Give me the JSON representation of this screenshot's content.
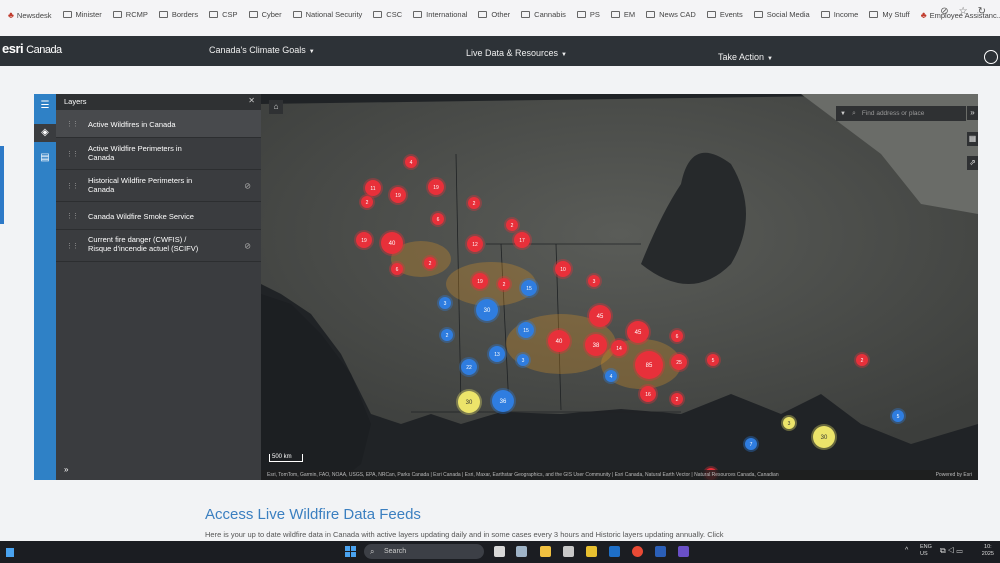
{
  "bookmarks": [
    {
      "label": "Newsdesk",
      "icon": "maple-leaf-icon"
    },
    {
      "label": "Minister",
      "icon": "folder-icon"
    },
    {
      "label": "RCMP",
      "icon": "folder-icon"
    },
    {
      "label": "Borders",
      "icon": "folder-icon"
    },
    {
      "label": "CSP",
      "icon": "folder-icon"
    },
    {
      "label": "Cyber",
      "icon": "folder-icon"
    },
    {
      "label": "National Security",
      "icon": "folder-icon"
    },
    {
      "label": "CSC",
      "icon": "folder-icon"
    },
    {
      "label": "International",
      "icon": "folder-icon"
    },
    {
      "label": "Other",
      "icon": "folder-icon"
    },
    {
      "label": "Cannabis",
      "icon": "folder-icon"
    },
    {
      "label": "PS",
      "icon": "folder-icon"
    },
    {
      "label": "EM",
      "icon": "folder-icon"
    },
    {
      "label": "News CAD",
      "icon": "folder-icon"
    },
    {
      "label": "Events",
      "icon": "folder-icon"
    },
    {
      "label": "Social Media",
      "icon": "folder-icon"
    },
    {
      "label": "Income",
      "icon": "folder-icon"
    },
    {
      "label": "My Stuff",
      "icon": "folder-icon"
    },
    {
      "label": "Employee Assistanc...",
      "icon": "maple-leaf-icon"
    }
  ],
  "header": {
    "logo": "esri",
    "logo_sub": "Canada",
    "nav": [
      "Canada's Climate Goals",
      "Live Data & Resources",
      "Take Action"
    ]
  },
  "layers": {
    "title": "Layers",
    "items": [
      {
        "label": "Active Wildfires in Canada",
        "visible": true
      },
      {
        "label": "Active Wildfire Perimeters in Canada",
        "visible": true
      },
      {
        "label": "Historical Wildfire Perimeters in Canada",
        "visible": false
      },
      {
        "label": "Canada Wildfire Smoke Service",
        "visible": true
      },
      {
        "label": "Current fire danger (CWFIS) / Risque d'incendie actuel (SCIFV)",
        "visible": false
      }
    ]
  },
  "map": {
    "search_placeholder": "Find address or place",
    "scale": "500 km",
    "attribution": "Esri, TomTom, Garmin, FAO, NOAA, USGS, EPA, NRCan, Parks Canada | Esri Canada | Esri, Maxar, Earthstar Geographics, and the GIS User Community | Esri Canada, Natural Earth Vector | Natural Resources Canada, Canadian",
    "powered_by": "Powered by Esri",
    "clusters": [
      {
        "n": "4",
        "c": "red"
      },
      {
        "n": "11",
        "c": "red"
      },
      {
        "n": "19",
        "c": "red"
      },
      {
        "n": "19",
        "c": "red"
      },
      {
        "n": "2",
        "c": "red"
      },
      {
        "n": "2",
        "c": "red"
      },
      {
        "n": "6",
        "c": "red"
      },
      {
        "n": "19",
        "c": "red"
      },
      {
        "n": "40",
        "c": "red"
      },
      {
        "n": "2",
        "c": "red"
      },
      {
        "n": "12",
        "c": "red"
      },
      {
        "n": "17",
        "c": "red"
      },
      {
        "n": "2",
        "c": "red"
      },
      {
        "n": "6",
        "c": "red"
      },
      {
        "n": "19",
        "c": "red"
      },
      {
        "n": "2",
        "c": "red"
      },
      {
        "n": "10",
        "c": "red"
      },
      {
        "n": "3",
        "c": "red"
      },
      {
        "n": "45",
        "c": "red"
      },
      {
        "n": "40",
        "c": "red"
      },
      {
        "n": "38",
        "c": "red"
      },
      {
        "n": "14",
        "c": "red"
      },
      {
        "n": "45",
        "c": "red"
      },
      {
        "n": "6",
        "c": "red"
      },
      {
        "n": "85",
        "c": "red"
      },
      {
        "n": "25",
        "c": "red"
      },
      {
        "n": "5",
        "c": "red"
      },
      {
        "n": "16",
        "c": "red"
      },
      {
        "n": "2",
        "c": "red"
      },
      {
        "n": "2",
        "c": "red"
      },
      {
        "n": "2",
        "c": "red"
      },
      {
        "n": "15",
        "c": "blue"
      },
      {
        "n": "3",
        "c": "blue"
      },
      {
        "n": "30",
        "c": "blue"
      },
      {
        "n": "2",
        "c": "blue"
      },
      {
        "n": "15",
        "c": "blue"
      },
      {
        "n": "13",
        "c": "blue"
      },
      {
        "n": "3",
        "c": "blue"
      },
      {
        "n": "22",
        "c": "blue"
      },
      {
        "n": "36",
        "c": "blue"
      },
      {
        "n": "4",
        "c": "blue"
      },
      {
        "n": "7",
        "c": "blue"
      },
      {
        "n": "5",
        "c": "blue"
      },
      {
        "n": "30",
        "c": "yellow"
      },
      {
        "n": "3",
        "c": "yellow"
      },
      {
        "n": "30",
        "c": "yellow"
      }
    ]
  },
  "section": {
    "title": "Access Live Wildfire Data Feeds",
    "body": "Here is your up to date wildfire data in Canada with active layers updating daily and in some cases every 3 hours and Historic layers updating annually. Click"
  },
  "taskbar": {
    "search_placeholder": "Search",
    "lang": "ENG",
    "region": "US",
    "time": "10:",
    "date": "2025"
  },
  "colors": {
    "red": "#e8303a",
    "blue": "#2f7de0",
    "yellow": "#ece46a",
    "nav": "#2d3237",
    "panel": "#3a3c3f",
    "accent": "#2f81c6"
  }
}
